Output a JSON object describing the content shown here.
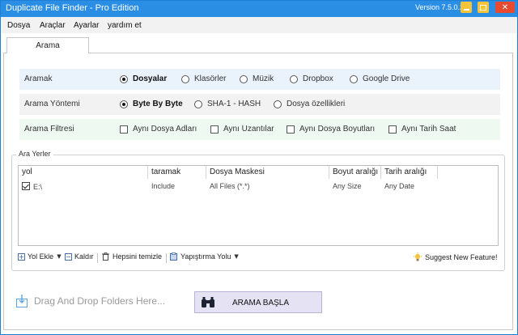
{
  "window": {
    "title": "Duplicate File Finder - Pro Edition",
    "version": "Version 7.5.0.2",
    "accent": "#2b8ee5"
  },
  "menu": [
    "Dosya",
    "Araçlar",
    "Ayarlar",
    "yardım et"
  ],
  "tabs": [
    {
      "label": "Arama",
      "active": true
    }
  ],
  "settings": {
    "search_type": {
      "label": "Aramak",
      "options": [
        {
          "label": "Dosyalar",
          "selected": true
        },
        {
          "label": "Klasörler",
          "selected": false
        },
        {
          "label": "Müzik",
          "selected": false
        },
        {
          "label": "Dropbox",
          "selected": false
        },
        {
          "label": "Google Drive",
          "selected": false
        }
      ]
    },
    "search_method": {
      "label": "Arama Yöntemi",
      "options": [
        {
          "label": "Byte By Byte",
          "selected": true
        },
        {
          "label": "SHA-1 - HASH",
          "selected": false
        },
        {
          "label": "Dosya özellikleri",
          "selected": false
        }
      ]
    },
    "search_filter": {
      "label": "Arama Filtresi",
      "options": [
        {
          "label": "Aynı Dosya Adları",
          "checked": false
        },
        {
          "label": "Aynı Uzantılar",
          "checked": false
        },
        {
          "label": "Aynı Dosya Boyutları",
          "checked": false
        },
        {
          "label": "Aynı Tarih Saat",
          "checked": false
        }
      ]
    }
  },
  "locations": {
    "group_title": "Ara Yerler",
    "columns": [
      "yol",
      "taramak",
      "Dosya Maskesi",
      "Boyut aralığı",
      "Tarih aralığı"
    ],
    "rows": [
      {
        "checked": true,
        "path": "E:\\",
        "scan": "Include",
        "mask": "All Files (*.*)",
        "size": "Any Size",
        "date": "Any Date"
      }
    ]
  },
  "toolbar": {
    "add_path": "Yol Ekle",
    "remove": "Kaldır",
    "clear_all": "Hepsini temizle",
    "paste_path": "Yapıştırma Yolu",
    "suggest": "Suggest New Feature!"
  },
  "drop_text": "Drag And Drop Folders Here...",
  "search_button": "ARAMA BAŞLA"
}
